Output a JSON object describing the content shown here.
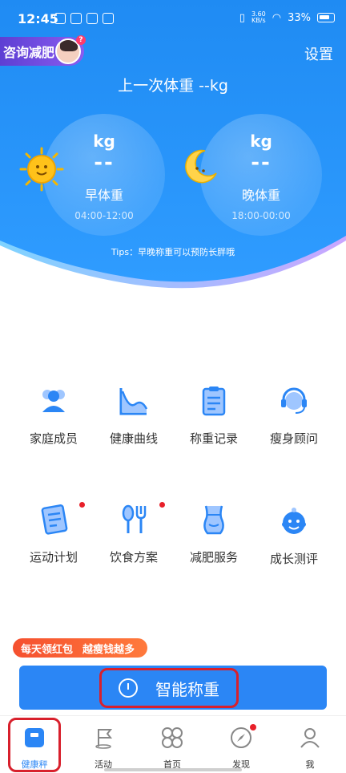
{
  "status_bar": {
    "time": "12:45",
    "net_speed_value": "3.60",
    "net_speed_unit": "KB/s",
    "battery": "33%"
  },
  "header": {
    "consult_label": "咨询减肥",
    "consult_badge": "?",
    "settings_label": "设置",
    "last_weight": "上一次体重 --kg",
    "tips": "Tips：早晚称重可以预防长胖哦"
  },
  "weights": [
    {
      "unit": "kg",
      "value": "--",
      "name": "早体重",
      "range": "04:00-12:00",
      "icon": "sun-icon"
    },
    {
      "unit": "kg",
      "value": "--",
      "name": "晚体重",
      "range": "18:00-00:00",
      "icon": "moon-icon"
    }
  ],
  "menu": [
    {
      "label": "家庭成员",
      "icon": "family-icon",
      "badge": false
    },
    {
      "label": "健康曲线",
      "icon": "curve-icon",
      "badge": false
    },
    {
      "label": "称重记录",
      "icon": "record-icon",
      "badge": false
    },
    {
      "label": "瘦身顾问",
      "icon": "advisor-icon",
      "badge": false
    },
    {
      "label": "运动计划",
      "icon": "exercise-plan-icon",
      "badge": true
    },
    {
      "label": "饮食方案",
      "icon": "diet-icon",
      "badge": true
    },
    {
      "label": "减肥服务",
      "icon": "body-icon",
      "badge": false
    },
    {
      "label": "成长测评",
      "icon": "baby-icon",
      "badge": false
    }
  ],
  "promo": {
    "left": "每天领红包",
    "right": "越瘦钱越多"
  },
  "main_button": {
    "label": "智能称重"
  },
  "tabs": [
    {
      "label": "健康秤",
      "icon": "scale-icon",
      "active": true
    },
    {
      "label": "活动",
      "icon": "flag-icon",
      "active": false
    },
    {
      "label": "首页",
      "icon": "grid-icon",
      "active": false
    },
    {
      "label": "发现",
      "icon": "compass-icon",
      "active": false
    },
    {
      "label": "我",
      "icon": "user-icon",
      "active": false
    }
  ],
  "colors": {
    "primary": "#2b86f5",
    "highlight": "#d8202c",
    "badge": "#e8202a"
  }
}
